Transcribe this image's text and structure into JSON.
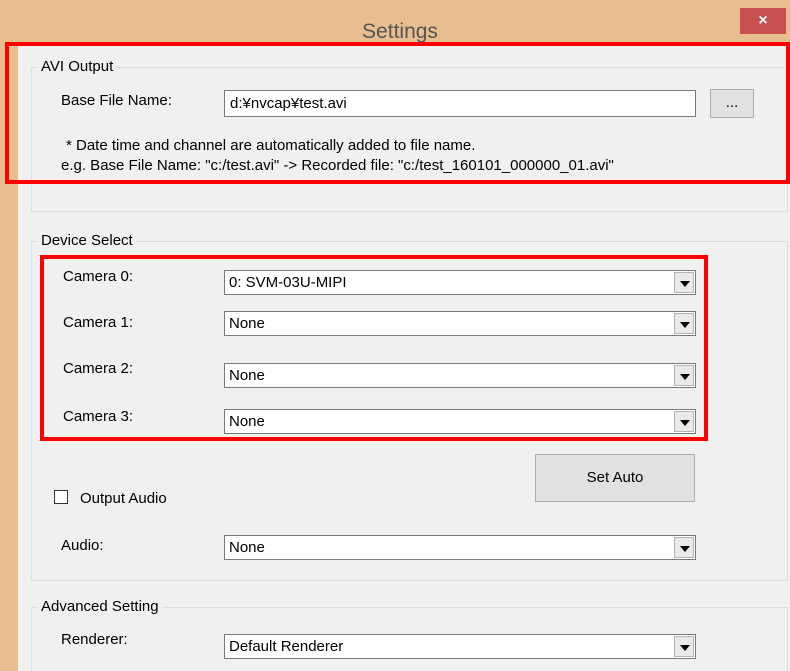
{
  "window": {
    "title": "Settings",
    "close_glyph": "×"
  },
  "avi_output": {
    "group_label": "AVI Output",
    "base_file_label": "Base File Name:",
    "base_file_value": "d:¥nvcap¥test.avi",
    "browse_label": "...",
    "note_line1": "* Date time and channel are automatically added to file name.",
    "note_line2": "e.g. Base File Name: \"c:/test.avi\" -> Recorded file: \"c:/test_160101_000000_01.avi\""
  },
  "device_select": {
    "group_label": "Device Select",
    "cameras": [
      {
        "label": "Camera 0:",
        "value": "0: SVM-03U-MIPI"
      },
      {
        "label": "Camera 1:",
        "value": "None"
      },
      {
        "label": "Camera 2:",
        "value": "None"
      },
      {
        "label": "Camera 3:",
        "value": "None"
      }
    ],
    "set_auto_label": "Set Auto",
    "output_audio_label": "Output Audio",
    "output_audio_checked": false,
    "audio_label": "Audio:",
    "audio_value": "None"
  },
  "advanced": {
    "group_label": "Advanced Setting",
    "renderer_label": "Renderer:",
    "renderer_value": "Default Renderer"
  },
  "colors": {
    "title_bar": "#e8bd8f",
    "close_button": "#c75050",
    "highlight": "#ff0000",
    "dialog_bg": "#f0f0f0"
  },
  "icons": {
    "close": "close-icon",
    "dropdown": "chevron-down-icon"
  }
}
